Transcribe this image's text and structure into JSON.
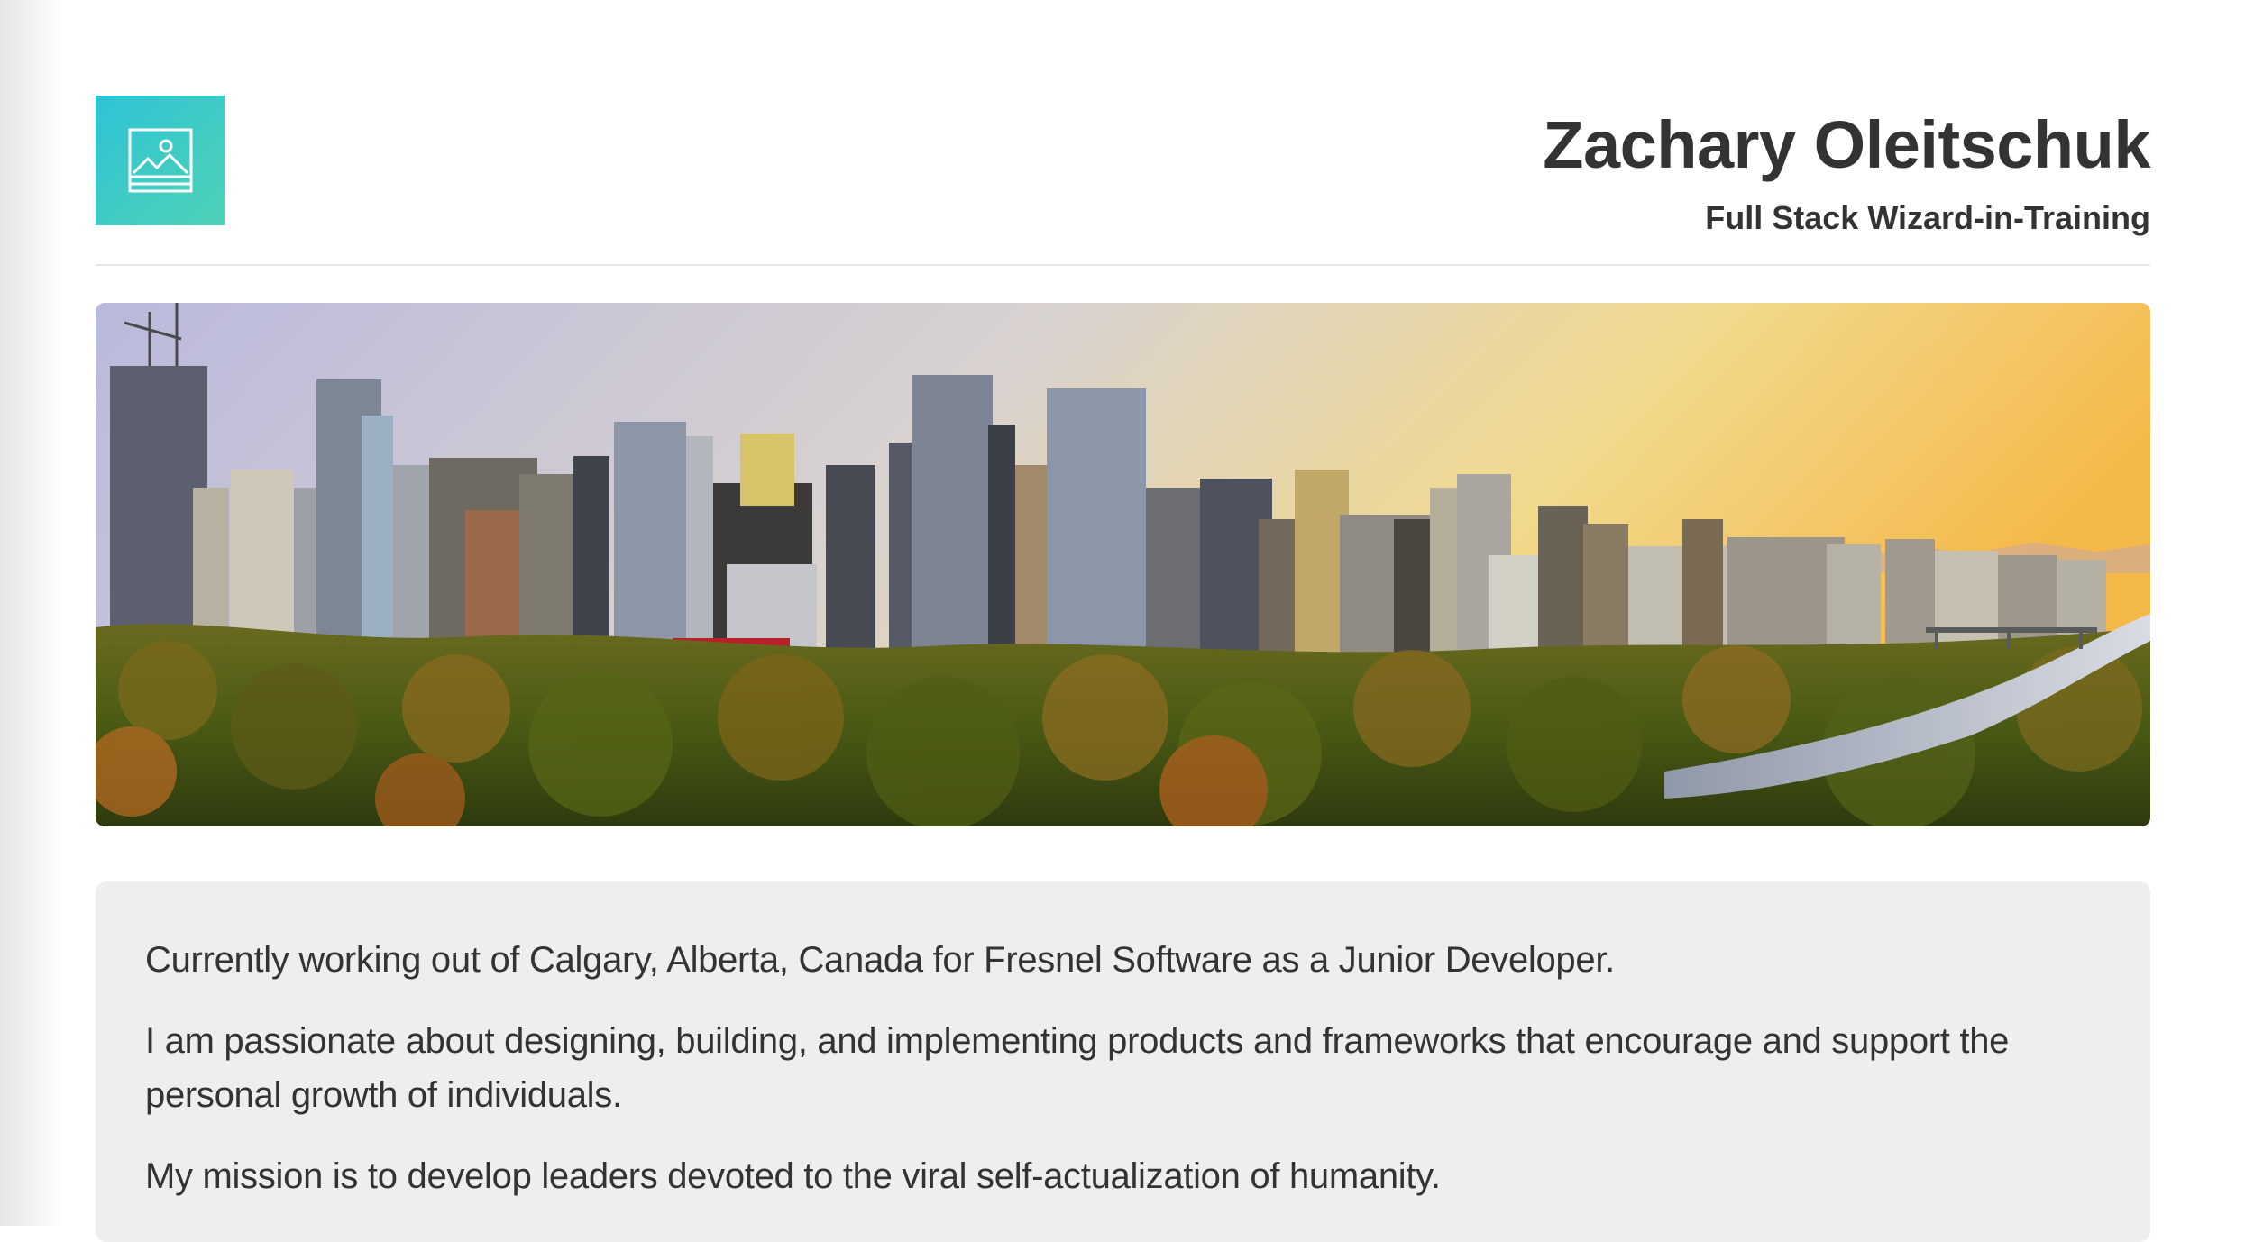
{
  "header": {
    "logo_icon": "image-placeholder-icon",
    "name": "Zachary Oleitschuk",
    "subtitle": "Full Stack Wizard-in-Training"
  },
  "hero": {
    "image": "city-skyline-panorama-at-sunset"
  },
  "about": {
    "paragraphs": [
      "Currently working out of Calgary, Alberta, Canada for Fresnel Software as a Junior Developer.",
      "I am passionate about designing, building, and implementing products and frameworks that encourage and support the personal growth of individuals.",
      "My mission is to develop leaders devoted to the viral self-actualization of humanity."
    ]
  },
  "colors": {
    "logo_gradient_start": "#2ec4d6",
    "logo_gradient_end": "#4fd1b5",
    "text": "#333333",
    "about_background": "#eeeeee"
  }
}
